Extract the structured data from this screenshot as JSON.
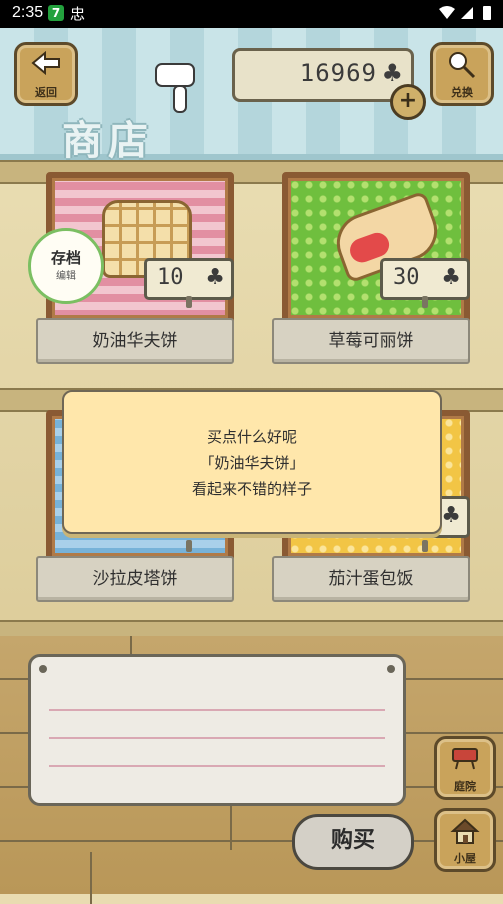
{
  "status_bar": {
    "time": "2:35",
    "badge": "7",
    "icon_glyph": "忠"
  },
  "header": {
    "back_label": "返回",
    "exchange_label": "兑换",
    "currency_value": "16969",
    "clover_glyph": "♣",
    "add_glyph": "+",
    "shop_title": "商店"
  },
  "items": [
    {
      "name": "奶油华夫饼",
      "price": "10",
      "cloth": "pink"
    },
    {
      "name": "草莓可丽饼",
      "price": "30",
      "cloth": "green"
    },
    {
      "name": "沙拉皮塔饼",
      "price": "",
      "cloth": "blue"
    },
    {
      "name": "茄汁蛋包饭",
      "price": "",
      "cloth": "yellow"
    }
  ],
  "save_badge": {
    "title": "存档",
    "subtitle": "编辑"
  },
  "dialog": {
    "line1": "买点什么好呢",
    "line2": "「奶油华夫饼」",
    "line3": "看起来不错的样子"
  },
  "buy_label": "购买",
  "nav": {
    "yard_label": "庭院",
    "house_label": "小屋"
  },
  "colors": {
    "accent_green": "#7bbf62",
    "dialog_bg": "#ffe7ab",
    "wood": "#c9a35b"
  }
}
